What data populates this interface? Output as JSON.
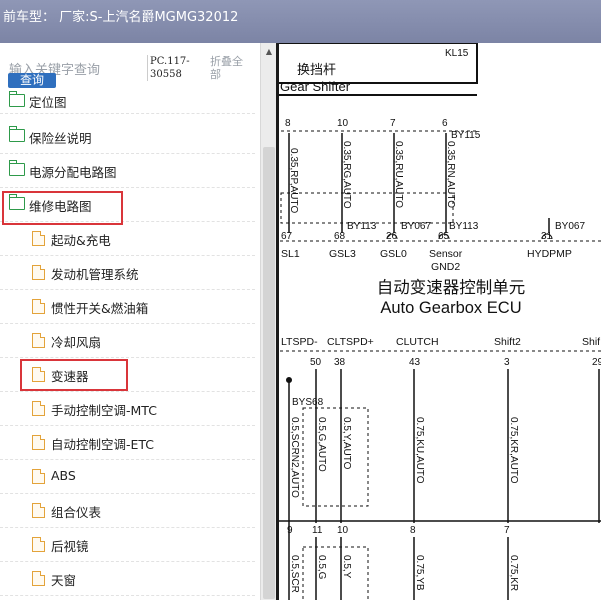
{
  "header": {
    "title": "前车型： 厂家:S-上汽名爵MGMG32012"
  },
  "sidebar": {
    "search_placeholder": "输入关键字查询",
    "search_button": "查询",
    "pc_label": "PC.117-30558",
    "collapse_all": "折叠全部",
    "items": [
      {
        "label": "定位图",
        "type": "folder",
        "level": 1
      },
      {
        "label": "保险丝说明",
        "type": "folder",
        "level": 1
      },
      {
        "label": "电源分配电路图",
        "type": "folder",
        "level": 1
      },
      {
        "label": "维修电路图",
        "type": "folder-open",
        "level": 1,
        "highlighted": true
      },
      {
        "label": "起动&充电",
        "type": "doc",
        "level": 2
      },
      {
        "label": "发动机管理系统",
        "type": "doc",
        "level": 2
      },
      {
        "label": "惯性开关&燃油箱",
        "type": "doc",
        "level": 2
      },
      {
        "label": "冷却风扇",
        "type": "doc",
        "level": 2
      },
      {
        "label": "变速器",
        "type": "doc",
        "level": 2,
        "highlighted": true
      },
      {
        "label": "手动控制空调-MTC",
        "type": "doc",
        "level": 2
      },
      {
        "label": "自动控制空调-ETC",
        "type": "doc",
        "level": 2
      },
      {
        "label": "ABS",
        "type": "doc",
        "level": 2
      },
      {
        "label": "组合仪表",
        "type": "doc",
        "level": 2
      },
      {
        "label": "后视镜",
        "type": "doc",
        "level": 2
      },
      {
        "label": "天窗",
        "type": "doc",
        "level": 2
      }
    ]
  },
  "diagram": {
    "shifter_connector": "KL15",
    "shifter_cn": "换挡杆",
    "shifter_en": "Gear Shifter",
    "top_pins": [
      "8",
      "10",
      "7",
      "6"
    ],
    "by115": "BY115",
    "top_wires": [
      "0.35,RP,AUTO",
      "0.35,RG,AUTO",
      "0.35,RU,AUTO",
      "0.35,RN,AUTO"
    ],
    "by113a": "BY113",
    "by067a": "BY067",
    "by113b": "BY113",
    "by067b": "BY067",
    "ecu_top_pins": [
      "67",
      "68",
      "26",
      "65",
      "31"
    ],
    "ecu_top_signals": [
      "SL1",
      "GSL3",
      "GSL0",
      "Sensor",
      "GND2",
      "HYDPMP"
    ],
    "ecu_cn": "自动变速器控制单元",
    "ecu_en": "Auto Gearbox ECU",
    "ecu_bottom_signals": [
      "LTSPD-",
      "CLTSPD+",
      "CLUTCH",
      "Shift2",
      "Shif"
    ],
    "ecu_bottom_pins": [
      "50",
      "38",
      "43",
      "3",
      "29"
    ],
    "bys68": "BYS68",
    "bottom_wires": [
      "0.5,SCRN2,AUTO",
      "0.5,G,AUTO",
      "0.5,Y,AUTO",
      "0.75,KU,AUTO",
      "0.75,KR,AUTO"
    ],
    "lower_pins": [
      "9",
      "11",
      "10",
      "8",
      "7"
    ],
    "lower_wires": [
      "0.5,SCR",
      "0.5,G",
      "0.5,Y",
      "0.75,YB",
      "0.75,KR"
    ],
    "colors": {
      "wire": "#111111",
      "highlight": "#d9353a",
      "title_bar": "#8790b0"
    }
  }
}
